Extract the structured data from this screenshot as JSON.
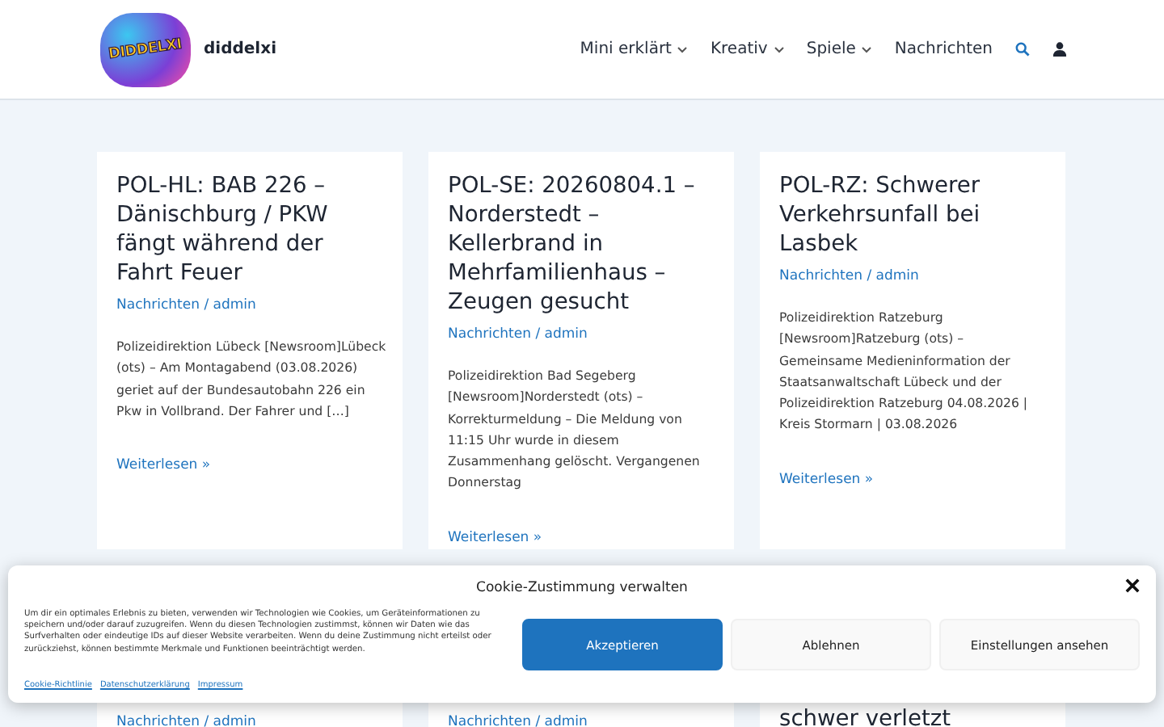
{
  "header": {
    "logo_text": "DIDDELXI",
    "site_name": "diddelxi",
    "nav": [
      {
        "label": "Mini erklärt",
        "has_submenu": true
      },
      {
        "label": "Kreativ",
        "has_submenu": true
      },
      {
        "label": "Spiele",
        "has_submenu": true
      },
      {
        "label": "Nachrichten",
        "has_submenu": false
      }
    ]
  },
  "posts": [
    {
      "title": "POL-HL: BAB 226 – Dänischburg / PKW fängt während der Fahrt Feuer",
      "meta": "Nachrichten / admin",
      "excerpt": "Polizeidirektion Lübeck [Newsroom]Lübeck (ots) – Am Montagabend (03.08.2026) geriet auf der Bundesautobahn 226 ein Pkw in Vollbrand. Der Fahrer und […]",
      "more": "Weiterlesen »"
    },
    {
      "title": "POL-SE: 20260804.1 – Norderstedt – Kellerbrand in Mehrfamilienhaus – Zeugen gesucht",
      "meta": "Nachrichten / admin",
      "excerpt": "Polizeidirektion Bad Segeberg [Newsroom]Norderstedt (ots) – Korrekturmeldung – Die Meldung von 11:15 Uhr wurde in diesem Zusammenhang gelöscht. Vergangenen Donnerstag",
      "more": "Weiterlesen »"
    },
    {
      "title": "POL-RZ: Schwerer Verkehrsunfall bei Lasbek",
      "meta": "Nachrichten / admin",
      "excerpt": "Polizeidirektion Ratzeburg [Newsroom]Ratzeburg (ots) – Gemeinsame Medieninformation der Staatsanwaltschaft Lübeck und der Polizeidirektion Ratzeburg 04.08.2026 | Kreis Stormarn | 03.08.2026",
      "more": "Weiterlesen »"
    }
  ],
  "posts_row_2": [
    {
      "kind": "meta",
      "text": "Nachrichten / admin"
    },
    {
      "kind": "meta",
      "text": "Nachrichten / admin"
    },
    {
      "kind": "title",
      "text": "schwer verletzt"
    }
  ],
  "cookie_banner": {
    "title": "Cookie-Zustimmung verwalten",
    "text": "Um dir ein optimales Erlebnis zu bieten, verwenden wir Technologien wie Cookies, um Geräteinformationen zu speichern und/oder darauf zuzugreifen. Wenn du diesen Technologien zustimmst, können wir Daten wie das Surfverhalten oder eindeutige IDs auf dieser Website verarbeiten. Wenn du deine Zustimmung nicht erteilst oder zurückziehst, können bestimmte Merkmale und Funktionen beeinträchtigt werden.",
    "links": [
      "Cookie-Richtlinie",
      "Datenschutzerklärung",
      "Impressum"
    ],
    "buttons": [
      {
        "label": "Akzeptieren",
        "kind": "primary"
      },
      {
        "label": "Ablehnen",
        "kind": "secondary"
      },
      {
        "label": "Einstellungen ansehen",
        "kind": "secondary"
      }
    ]
  }
}
